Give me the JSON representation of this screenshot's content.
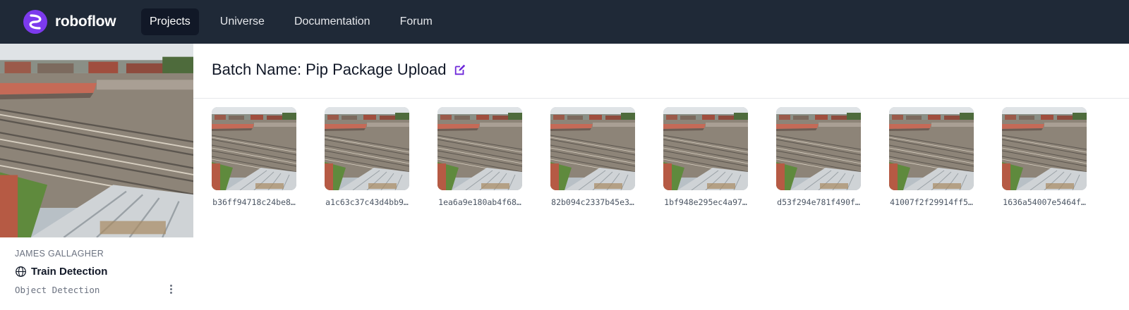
{
  "nav": {
    "brand": "roboflow",
    "items": [
      {
        "label": "Projects",
        "active": true
      },
      {
        "label": "Universe",
        "active": false
      },
      {
        "label": "Documentation",
        "active": false
      },
      {
        "label": "Forum",
        "active": false
      }
    ]
  },
  "sidebar": {
    "owner": "JAMES GALLAGHER",
    "project_name": "Train Detection",
    "project_type": "Object Detection",
    "visibility_icon": "globe-icon",
    "menu_icon": "more-vertical-icon"
  },
  "batch": {
    "label": "Batch Name:",
    "name": "Pip Package Upload",
    "edit_icon": "edit-icon"
  },
  "images": [
    {
      "label": "b36ff94718c24be8…"
    },
    {
      "label": "a1c63c37c43d4bb9…"
    },
    {
      "label": "1ea6a9e180ab4f68…"
    },
    {
      "label": "82b094c2337b45e3…"
    },
    {
      "label": "1bf948e295ec4a97…"
    },
    {
      "label": "d53f294e781f490f…"
    },
    {
      "label": "41007f2f29914ff5…"
    },
    {
      "label": "1636a54007e5464f…"
    }
  ],
  "colors": {
    "nav_bg": "#1f2937",
    "nav_active_bg": "#111827",
    "accent": "#6d28d9"
  }
}
